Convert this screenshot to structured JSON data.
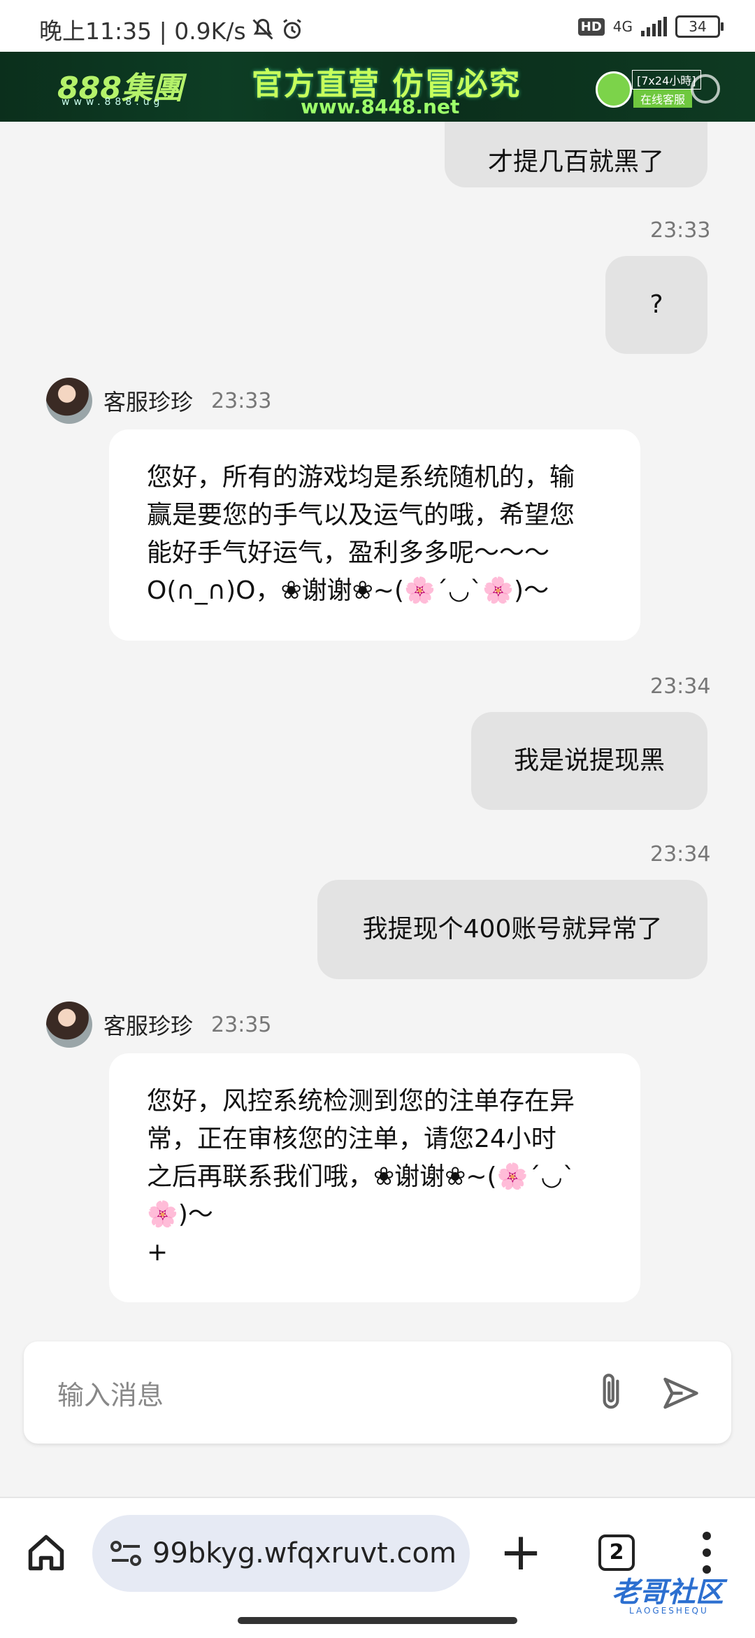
{
  "status_bar": {
    "time_text": "晚上11:35 | 0.9K/s",
    "hd_badge": "HD",
    "network": "4G",
    "battery": "34"
  },
  "banner": {
    "logo": "888集團",
    "logo_sub": "www.888.ug",
    "slogan": "官方直营 仿冒必究",
    "url": "www.8448.net",
    "service_hours": "[7x24小時]",
    "service_online": "在线客服"
  },
  "chat": {
    "messages": [
      {
        "sender": "me",
        "text": "才提几百就黑了"
      },
      {
        "sender": "me",
        "time": "23:33",
        "text": "?"
      },
      {
        "sender": "agent",
        "name": "客服珍珍",
        "time": "23:33",
        "lines": [
          "您好，所有的游戏均是系统随机的，输",
          "赢是要您的手气以及运气的哦，希望您",
          "能好手气好运气，盈利多多呢～～～",
          "O(∩_∩)O，❀谢谢❀~(🌸´◡`🌸)～"
        ]
      },
      {
        "sender": "me",
        "time": "23:34",
        "text": "我是说提现黑"
      },
      {
        "sender": "me",
        "time": "23:34",
        "text": "我提现个400账号就异常了"
      },
      {
        "sender": "agent",
        "name": "客服珍珍",
        "time": "23:35",
        "lines": [
          "您好，风控系统检测到您的注单存在异",
          "常，正在审核您的注单，请您24小时",
          "之后再联系我们哦，❀谢谢❀~(🌸´◡`",
          "🌸)～",
          "+"
        ]
      }
    ]
  },
  "input": {
    "placeholder": "输入消息",
    "attach_icon": "paperclip-icon",
    "send_icon": "send-icon"
  },
  "browser": {
    "url": "99bkyg.wfqxruvt.com",
    "tab_count": "2"
  },
  "watermark": {
    "text": "老哥社区",
    "sub": "LAOGESHEQU"
  }
}
